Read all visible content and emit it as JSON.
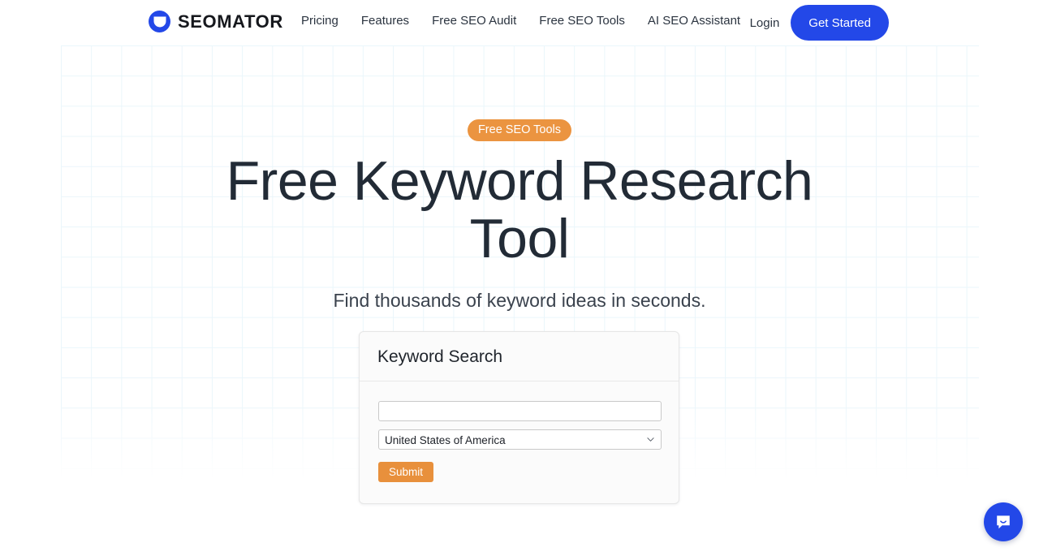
{
  "header": {
    "brand": {
      "name": "SEOMATOR",
      "logo_icon": "seomator-circle-logo",
      "logo_color": "#2348E8"
    },
    "nav_items": [
      {
        "label": "Pricing"
      },
      {
        "label": "Features"
      },
      {
        "label": "Free SEO Audit"
      },
      {
        "label": "Free SEO Tools"
      },
      {
        "label": "AI SEO Assistant"
      }
    ],
    "login_label": "Login",
    "cta_label": "Get Started",
    "cta_color": "#2348E8"
  },
  "hero": {
    "badge_label": "Free SEO Tools",
    "badge_color": "#EB9440",
    "title": "Free Keyword Research Tool",
    "subtitle": "Find thousands of keyword ideas in seconds."
  },
  "card": {
    "title": "Keyword Search",
    "keyword_input": {
      "value": "",
      "placeholder": ""
    },
    "country_select": {
      "selected": "United States of America",
      "options": [
        "United States of America"
      ],
      "chevron_icon": "chevron-down-icon"
    },
    "submit_label": "Submit",
    "submit_color": "#E8903C"
  },
  "chat": {
    "icon": "chat-bubble-smile-icon",
    "color": "#2348E8"
  }
}
